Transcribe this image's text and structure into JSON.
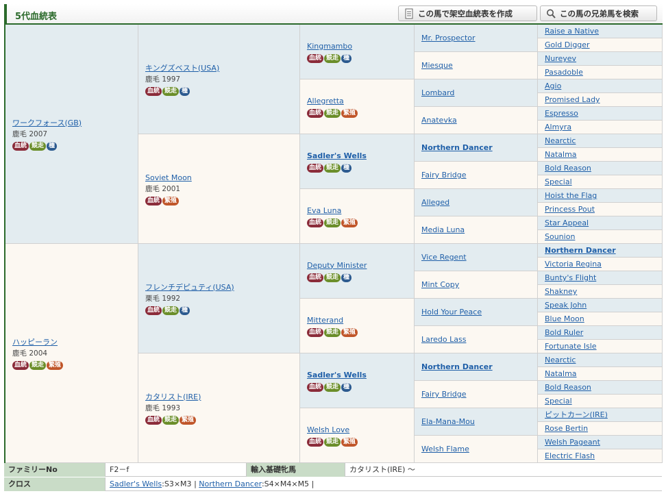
{
  "header": {
    "title": "5代血統表",
    "create_button": "この馬で架空血統表を作成",
    "search_button": "この馬の兄弟馬を検索"
  },
  "badges": {
    "blood": "血統",
    "race": "競走",
    "stud": "種",
    "breed": "繁殖"
  },
  "gen1": [
    {
      "name": "ワークフォース(GB)",
      "info": "鹿毛 2007",
      "badges": [
        "blood",
        "race",
        "stud"
      ],
      "sex": "male"
    },
    {
      "name": "ハッピーラン",
      "info": "鹿毛 2004",
      "badges": [
        "blood",
        "race",
        "breed"
      ],
      "sex": "female"
    }
  ],
  "gen2": [
    {
      "name": "キングズベスト(USA)",
      "info": "鹿毛 1997",
      "badges": [
        "blood",
        "race",
        "stud"
      ],
      "sex": "male"
    },
    {
      "name": "Soviet Moon",
      "info": "鹿毛 2001",
      "badges": [
        "blood",
        "breed"
      ],
      "sex": "female"
    },
    {
      "name": "フレンチデピュティ(USA)",
      "info": "栗毛 1992",
      "badges": [
        "blood",
        "race",
        "stud"
      ],
      "sex": "male"
    },
    {
      "name": "カタリスト(IRE)",
      "info": "鹿毛 1993",
      "badges": [
        "blood",
        "race",
        "breed"
      ],
      "sex": "female"
    }
  ],
  "gen3": [
    {
      "name": "Kingmambo",
      "badges": [
        "blood",
        "race",
        "stud"
      ],
      "sex": "male",
      "bold": false
    },
    {
      "name": "Allegretta",
      "badges": [
        "blood",
        "race",
        "breed"
      ],
      "sex": "female",
      "bold": false
    },
    {
      "name": "Sadler's Wells",
      "badges": [
        "blood",
        "race",
        "stud"
      ],
      "sex": "male",
      "bold": true
    },
    {
      "name": "Eva Luna",
      "badges": [
        "blood",
        "race",
        "breed"
      ],
      "sex": "female",
      "bold": false
    },
    {
      "name": "Deputy Minister",
      "badges": [
        "blood",
        "race",
        "stud"
      ],
      "sex": "male",
      "bold": false
    },
    {
      "name": "Mitterand",
      "badges": [
        "blood",
        "race",
        "breed"
      ],
      "sex": "female",
      "bold": false
    },
    {
      "name": "Sadler's Wells",
      "badges": [
        "blood",
        "race",
        "stud"
      ],
      "sex": "male",
      "bold": true
    },
    {
      "name": "Welsh Love",
      "badges": [
        "blood",
        "race",
        "breed"
      ],
      "sex": "female",
      "bold": false
    }
  ],
  "gen4": [
    {
      "name": "Mr. Prospector",
      "sex": "male",
      "bold": false
    },
    {
      "name": "Miesque",
      "sex": "female",
      "bold": false
    },
    {
      "name": "Lombard",
      "sex": "male",
      "bold": false
    },
    {
      "name": "Anatevka",
      "sex": "female",
      "bold": false
    },
    {
      "name": "Northern Dancer",
      "sex": "male",
      "bold": true
    },
    {
      "name": "Fairy Bridge",
      "sex": "female",
      "bold": false
    },
    {
      "name": "Alleged",
      "sex": "male",
      "bold": false
    },
    {
      "name": "Media Luna",
      "sex": "female",
      "bold": false
    },
    {
      "name": "Vice Regent",
      "sex": "male",
      "bold": false
    },
    {
      "name": "Mint Copy",
      "sex": "female",
      "bold": false
    },
    {
      "name": "Hold Your Peace",
      "sex": "male",
      "bold": false
    },
    {
      "name": "Laredo Lass",
      "sex": "female",
      "bold": false
    },
    {
      "name": "Northern Dancer",
      "sex": "male",
      "bold": true
    },
    {
      "name": "Fairy Bridge",
      "sex": "female",
      "bold": false
    },
    {
      "name": "Ela-Mana-Mou",
      "sex": "male",
      "bold": false
    },
    {
      "name": "Welsh Flame",
      "sex": "female",
      "bold": false
    }
  ],
  "gen5": [
    {
      "name": "Raise a Native",
      "sex": "male",
      "bold": false
    },
    {
      "name": "Gold Digger",
      "sex": "female",
      "bold": false
    },
    {
      "name": "Nureyev",
      "sex": "male",
      "bold": false
    },
    {
      "name": "Pasadoble",
      "sex": "female",
      "bold": false
    },
    {
      "name": "Agio",
      "sex": "male",
      "bold": false
    },
    {
      "name": "Promised Lady",
      "sex": "female",
      "bold": false
    },
    {
      "name": "Espresso",
      "sex": "male",
      "bold": false
    },
    {
      "name": "Almyra",
      "sex": "female",
      "bold": false
    },
    {
      "name": "Nearctic",
      "sex": "male",
      "bold": false
    },
    {
      "name": "Natalma",
      "sex": "female",
      "bold": false
    },
    {
      "name": "Bold Reason",
      "sex": "male",
      "bold": false
    },
    {
      "name": "Special",
      "sex": "female",
      "bold": false
    },
    {
      "name": "Hoist the Flag",
      "sex": "male",
      "bold": false
    },
    {
      "name": "Princess Pout",
      "sex": "female",
      "bold": false
    },
    {
      "name": "Star Appeal",
      "sex": "male",
      "bold": false
    },
    {
      "name": "Sounion",
      "sex": "female",
      "bold": false
    },
    {
      "name": "Northern Dancer",
      "sex": "male",
      "bold": true
    },
    {
      "name": "Victoria Regina",
      "sex": "female",
      "bold": false
    },
    {
      "name": "Bunty's Flight",
      "sex": "male",
      "bold": false
    },
    {
      "name": "Shakney",
      "sex": "female",
      "bold": false
    },
    {
      "name": "Speak John",
      "sex": "male",
      "bold": false
    },
    {
      "name": "Blue Moon",
      "sex": "female",
      "bold": false
    },
    {
      "name": "Bold Ruler",
      "sex": "male",
      "bold": false
    },
    {
      "name": "Fortunate Isle",
      "sex": "female",
      "bold": false
    },
    {
      "name": "Nearctic",
      "sex": "male",
      "bold": false
    },
    {
      "name": "Natalma",
      "sex": "female",
      "bold": false
    },
    {
      "name": "Bold Reason",
      "sex": "male",
      "bold": false
    },
    {
      "name": "Special",
      "sex": "female",
      "bold": false
    },
    {
      "name": "ピットカーン(IRE)",
      "sex": "male",
      "bold": false
    },
    {
      "name": "Rose Bertin",
      "sex": "female",
      "bold": false
    },
    {
      "name": "Welsh Pageant",
      "sex": "male",
      "bold": false
    },
    {
      "name": "Electric Flash",
      "sex": "female",
      "bold": false
    }
  ],
  "footer": {
    "family_label": "ファミリーNo",
    "family_value": "F2－f",
    "import_label": "輸入基礎牝馬",
    "import_value": "カタリスト(IRE) ～",
    "cross_label": "クロス",
    "crosses": [
      {
        "horse": "Sadler's Wells",
        "detail": ":S3×M3"
      },
      {
        "horse": "Northern Dancer",
        "detail": ":S4×M4×M5"
      }
    ],
    "separator": "|"
  },
  "colors": {
    "accent": "#2b6a2b",
    "male_bg": "#e3ecf0",
    "female_bg": "#fcf8f2",
    "link": "#1f5fa8"
  }
}
